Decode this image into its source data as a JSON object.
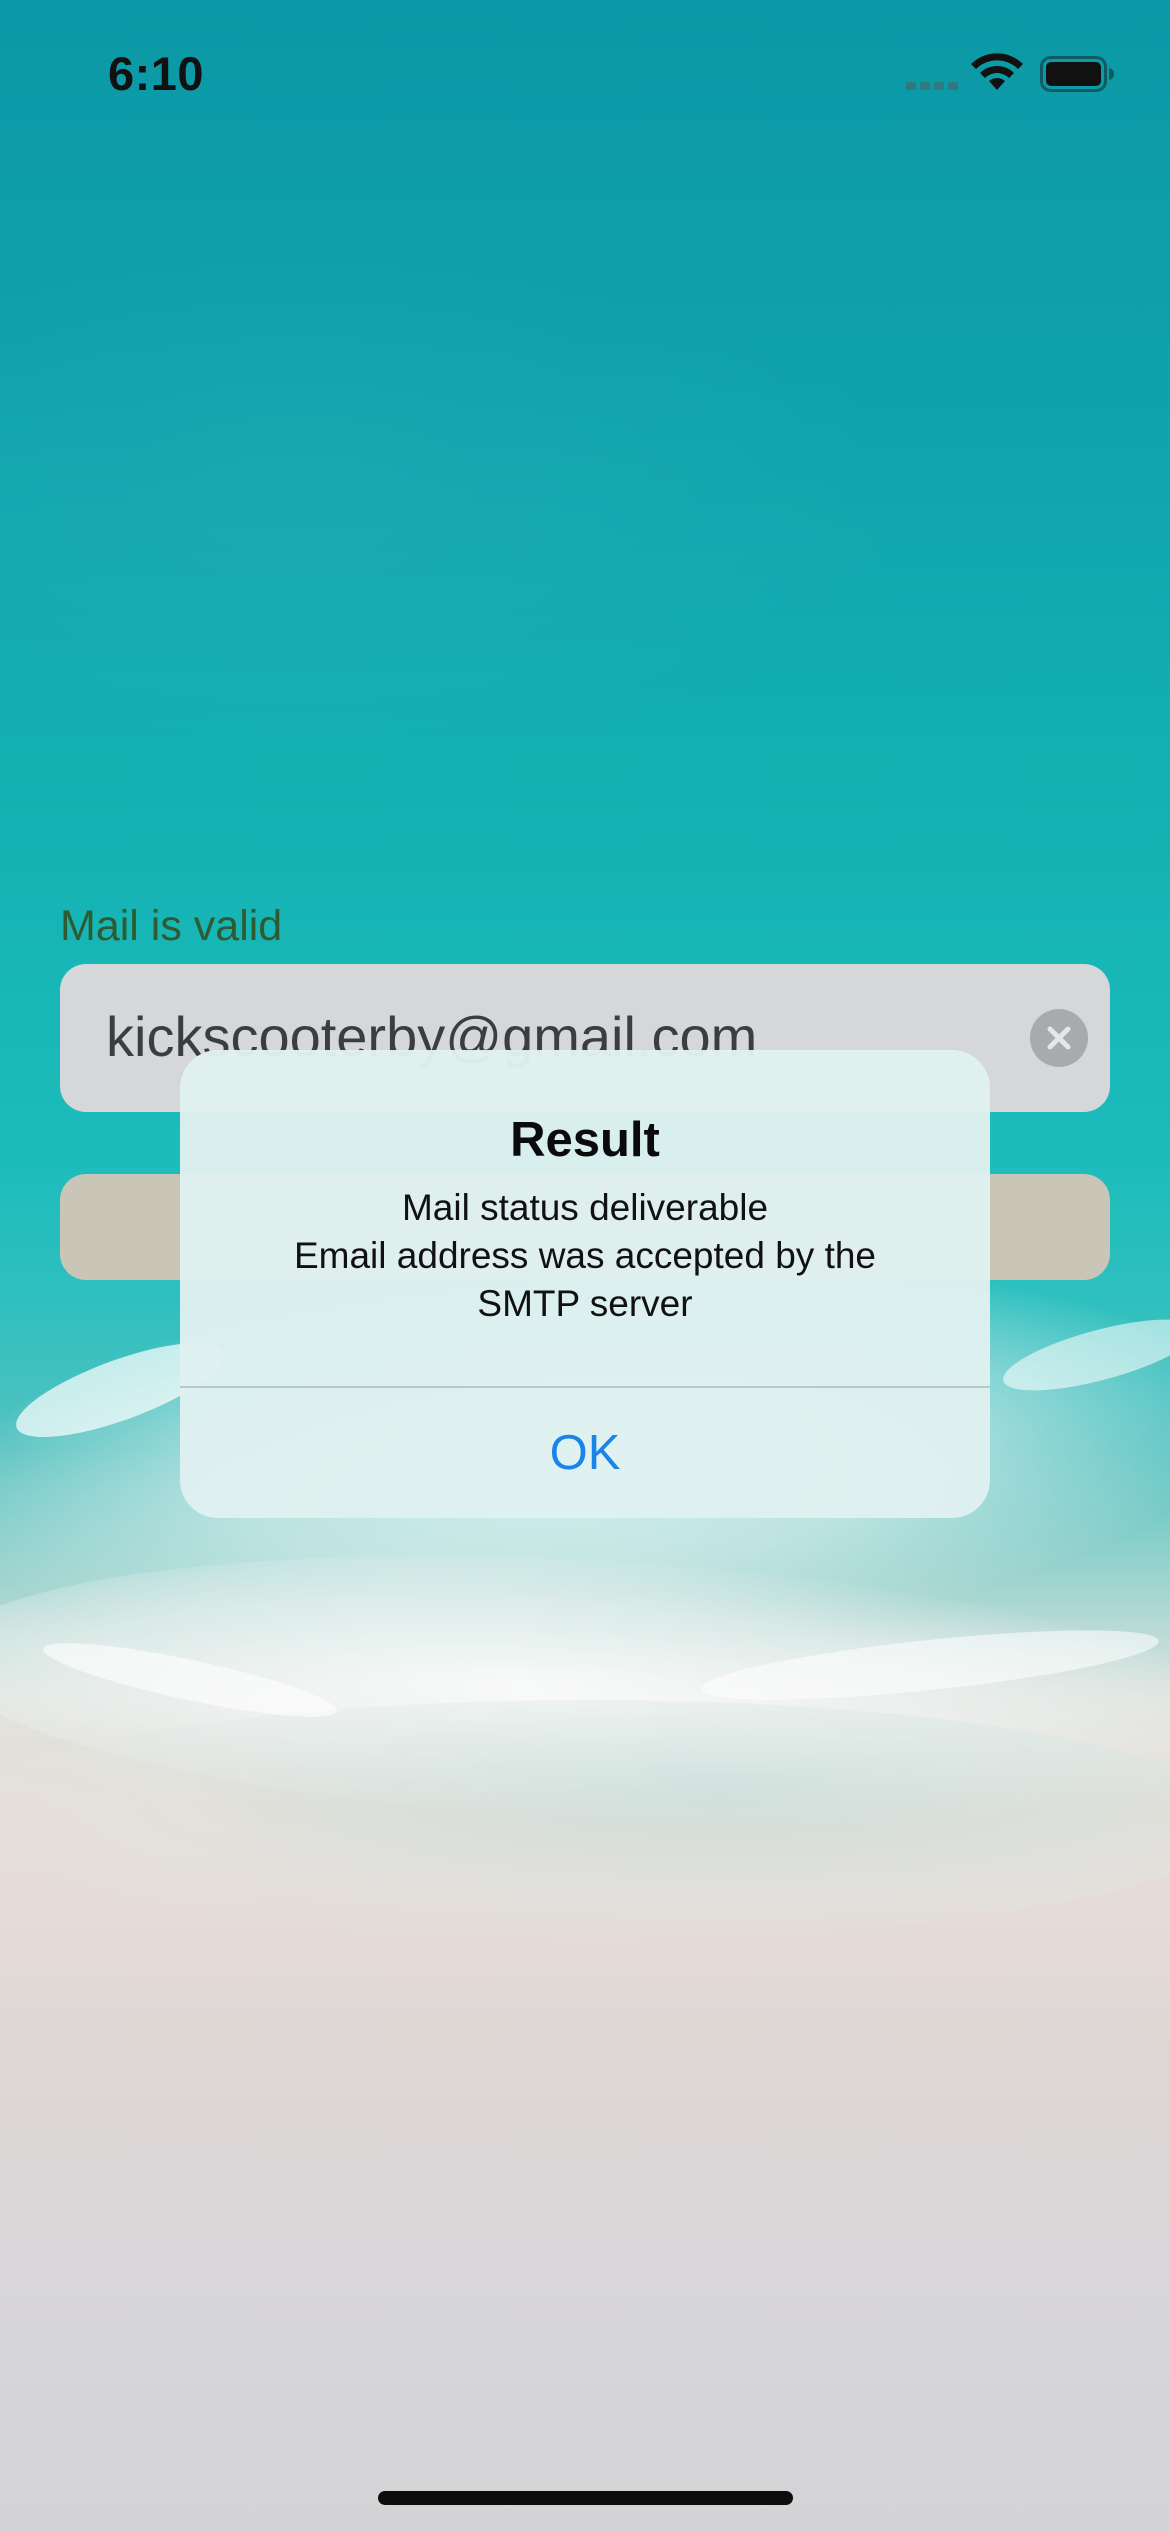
{
  "status_bar": {
    "time": "6:10",
    "wifi_icon": "wifi-icon",
    "battery_icon": "battery-full-icon",
    "signal_icon": "cellular-signal-icon"
  },
  "form": {
    "validation_label": "Mail is valid",
    "email_value": "kickscooterby@gmail.com",
    "clear_icon": "clear-circle-x-icon"
  },
  "alert": {
    "title": "Result",
    "message_lines": [
      "Mail status deliverable",
      "Email address was accepted by the",
      "SMTP server"
    ],
    "ok_label": "OK"
  },
  "colors": {
    "alert_button": "#1a84e8",
    "validation_label": "#2f5a32"
  }
}
